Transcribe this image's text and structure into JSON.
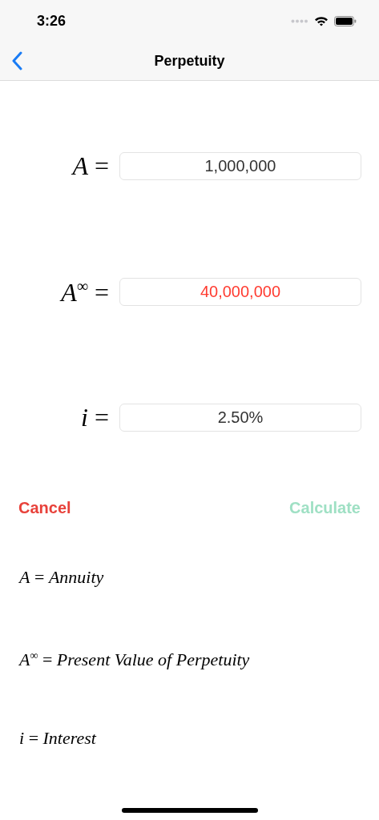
{
  "status_bar": {
    "time": "3:26"
  },
  "nav": {
    "title": "Perpetuity"
  },
  "fields": [
    {
      "label": "*A* =",
      "value": "1,000,000",
      "color": "#333333"
    },
    {
      "label": "*A*$^{∞}$ =",
      "value": "40,000,000",
      "color": "#ff3b30"
    },
    {
      "label": "*i* =",
      "value": "2.50%",
      "color": "#333333"
    }
  ],
  "actions": [
    {
      "label": "Cancel",
      "kind": "cancel",
      "disabled": false
    },
    {
      "label": "Calculate",
      "kind": "confirm",
      "disabled": true
    }
  ],
  "legend": [
    "*A* = *Annuity*",
    "*A*$^{∞}$ = *Present Value of Perpetuity*",
    "*i* = *Interest*"
  ]
}
